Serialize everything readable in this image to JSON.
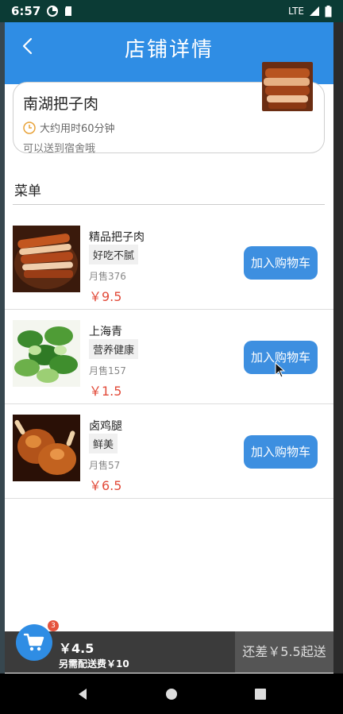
{
  "status": {
    "time": "6:57",
    "network": "LTE"
  },
  "header": {
    "title": "店铺详情"
  },
  "store": {
    "name": "南湖把子肉",
    "time": "大约用时60分钟",
    "delivery": "可以送到宿舍哦"
  },
  "menu": {
    "title": "菜单",
    "items": [
      {
        "name": "精品把子肉",
        "tag": "好吃不腻",
        "sales": "月售376",
        "price": "￥9.5",
        "button": "加入购物车"
      },
      {
        "name": "上海青",
        "tag": "营养健康",
        "sales": "月售157",
        "price": "￥1.5",
        "button": "加入购物车"
      },
      {
        "name": "卤鸡腿",
        "tag": "鲜美",
        "sales": "月售57",
        "price": "￥6.5",
        "button": "加入购物车"
      }
    ]
  },
  "cart": {
    "badge": "3",
    "amount": "￥4.5",
    "fee": "另需配送费￥10",
    "checkout": "还差￥5.5起送"
  },
  "colors": {
    "primary": "#2f8de4",
    "price": "#e24b3a",
    "cart_bar": "#3b3b3b"
  }
}
